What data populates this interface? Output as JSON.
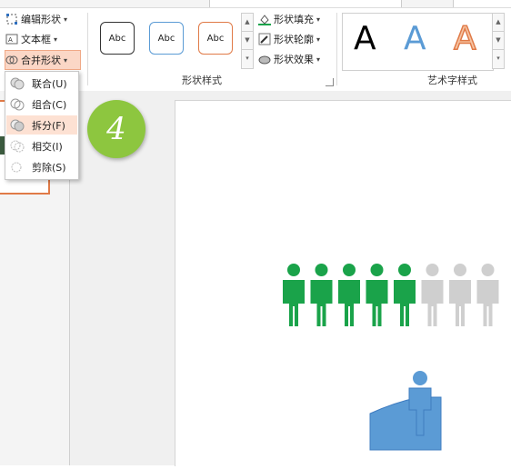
{
  "ribbon": {
    "edit_shape": "编辑形状",
    "text_box": "文本框",
    "merge_shapes": "合并形状",
    "shape_styles_label": "形状样式",
    "shape_style_samples": [
      "Abc",
      "Abc",
      "Abc"
    ],
    "shape_fill": "形状填充",
    "shape_outline": "形状轮廓",
    "shape_effects": "形状效果",
    "wordart_label": "艺术字样式",
    "wordart_samples": [
      "A",
      "A",
      "A"
    ]
  },
  "merge_menu": {
    "items": [
      {
        "label": "联合(U)",
        "highlighted": false
      },
      {
        "label": "组合(C)",
        "highlighted": false
      },
      {
        "label": "拆分(F)",
        "highlighted": true
      },
      {
        "label": "相交(I)",
        "highlighted": false
      },
      {
        "label": "剪除(S)",
        "highlighted": false
      }
    ]
  },
  "step_badge": "4",
  "slide": {
    "people_colors": [
      "#1aa34a",
      "#1aa34a",
      "#1aa34a",
      "#1aa34a",
      "#1aa34a",
      "#cfcfcf",
      "#cfcfcf",
      "#cfcfcf"
    ],
    "highlight_color": "#5b9bd5"
  },
  "colors": {
    "accent": "#e07a47",
    "green": "#1aa34a",
    "badge": "#8dc63f",
    "blue": "#5b9bd5"
  }
}
